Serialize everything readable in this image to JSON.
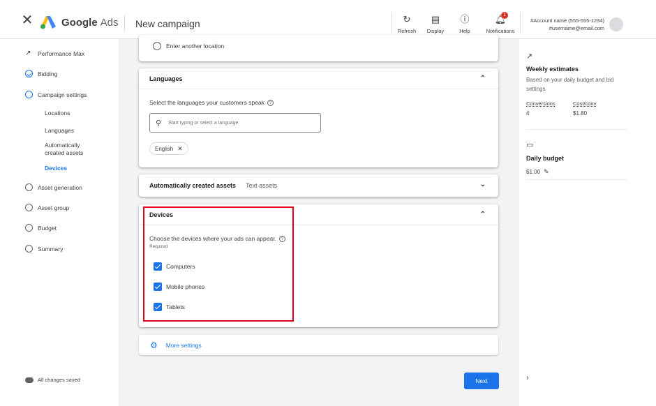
{
  "header": {
    "brand_google": "Google",
    "brand_ads": "Ads",
    "page_title": "New campaign",
    "buttons": [
      {
        "label": "Refresh",
        "icon": "refresh-icon"
      },
      {
        "label": "Display",
        "icon": "display-icon"
      },
      {
        "label": "Help",
        "icon": "help-icon"
      },
      {
        "label": "Notifications",
        "icon": "bell-icon"
      }
    ],
    "notification_count": "1",
    "account_name": "#Account name (555-555-1234)",
    "account_email": "#username@email.com"
  },
  "sidebar": {
    "items": [
      {
        "label": "Performance Max",
        "state": "trend"
      },
      {
        "label": "Bidding",
        "state": "done"
      },
      {
        "label": "Campaign settings",
        "state": "current"
      },
      {
        "label": "Asset generation",
        "state": "todo"
      },
      {
        "label": "Asset group",
        "state": "todo"
      },
      {
        "label": "Budget",
        "state": "todo"
      },
      {
        "label": "Summary",
        "state": "todo"
      }
    ],
    "sub_items": [
      {
        "label": "Locations"
      },
      {
        "label": "Languages"
      },
      {
        "label": "Automatically\ncreated assets"
      },
      {
        "label": "Devices",
        "active": true
      }
    ],
    "saved_status": "All changes saved"
  },
  "locations": {
    "enter_another": "Enter another location"
  },
  "languages": {
    "title": "Languages",
    "question": "Select the languages your customers speak",
    "search_placeholder": "Start typing or select a language",
    "chips": [
      "English"
    ]
  },
  "auto_assets": {
    "title": "Automatically created assets",
    "value": "Text assets"
  },
  "devices": {
    "title": "Devices",
    "question": "Choose the devices where your ads can appear.",
    "required": "Required",
    "options": [
      {
        "label": "Computers",
        "checked": true
      },
      {
        "label": "Mobile phones",
        "checked": true
      },
      {
        "label": "Tablets",
        "checked": true
      }
    ]
  },
  "more_settings": "More settings",
  "next_label": "Next",
  "right_panel": {
    "weekly_title": "Weekly estimates",
    "weekly_sub": "Based on your daily budget and bid settings",
    "conversions_label": "Conversions",
    "conversions_value": "4",
    "cost_label": "Cost/conv",
    "cost_value": "$1.80",
    "daily_title": "Daily budget",
    "daily_value": "$1.00"
  },
  "colors": {
    "accent": "#1a73e8",
    "highlight": "#e0001b",
    "background": "#f1f3f4"
  }
}
